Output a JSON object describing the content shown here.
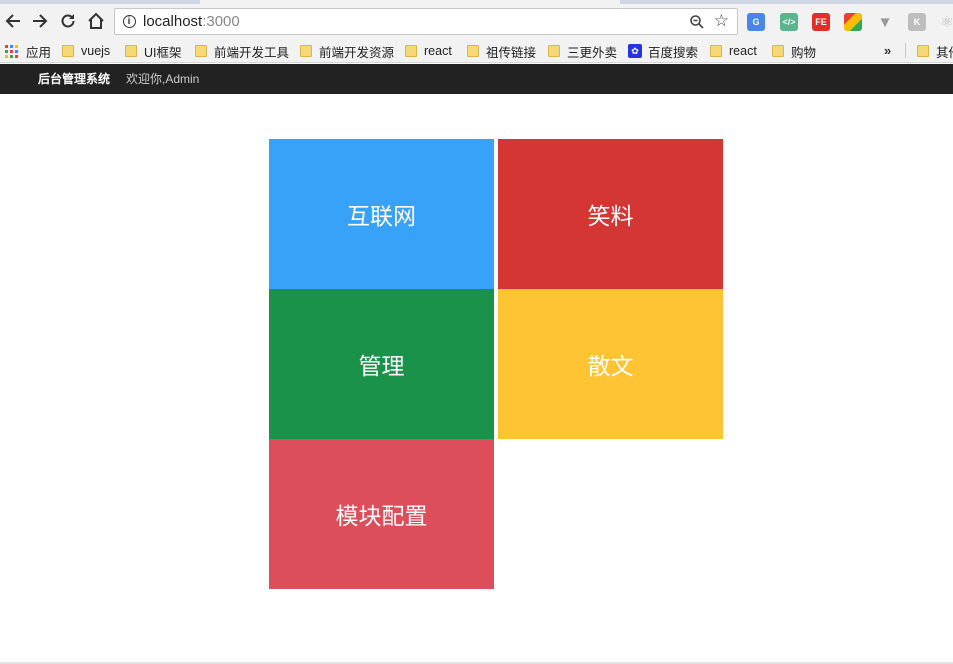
{
  "browser": {
    "url_host": "localhost",
    "url_port": ":3000",
    "bookmarks": [
      {
        "label": "应用",
        "icon": "apps-grid-icon"
      },
      {
        "label": "vuejs",
        "icon": "folder-icon"
      },
      {
        "label": "UI框架",
        "icon": "folder-icon"
      },
      {
        "label": "前端开发工具",
        "icon": "folder-icon"
      },
      {
        "label": "前端开发资源",
        "icon": "folder-icon"
      },
      {
        "label": "react",
        "icon": "folder-icon"
      },
      {
        "label": "祖传链接",
        "icon": "folder-icon"
      },
      {
        "label": "三更外卖",
        "icon": "folder-icon"
      },
      {
        "label": "百度搜索",
        "icon": "baidu-paw-icon"
      },
      {
        "label": "react",
        "icon": "folder-icon"
      },
      {
        "label": "购物",
        "icon": "folder-icon"
      },
      {
        "label": "其他",
        "icon": "folder-icon"
      }
    ],
    "overflow_label": "»"
  },
  "app": {
    "brand": "后台管理系统",
    "welcome": "欢迎你,Admin"
  },
  "tiles": [
    {
      "label": "互联网",
      "color": "#38a2f9"
    },
    {
      "label": "笑料",
      "color": "#d43733"
    },
    {
      "label": "管理",
      "color": "#1b924a"
    },
    {
      "label": "散文",
      "color": "#ffc433"
    },
    {
      "label": "模块配置",
      "color": "#dc4e5a"
    }
  ],
  "extensions": [
    "google-translate-icon",
    "code-icon",
    "fe-icon",
    "colorzilla-icon",
    "vue-devtools-icon",
    "kitematic-icon",
    "react-devtools-icon"
  ]
}
